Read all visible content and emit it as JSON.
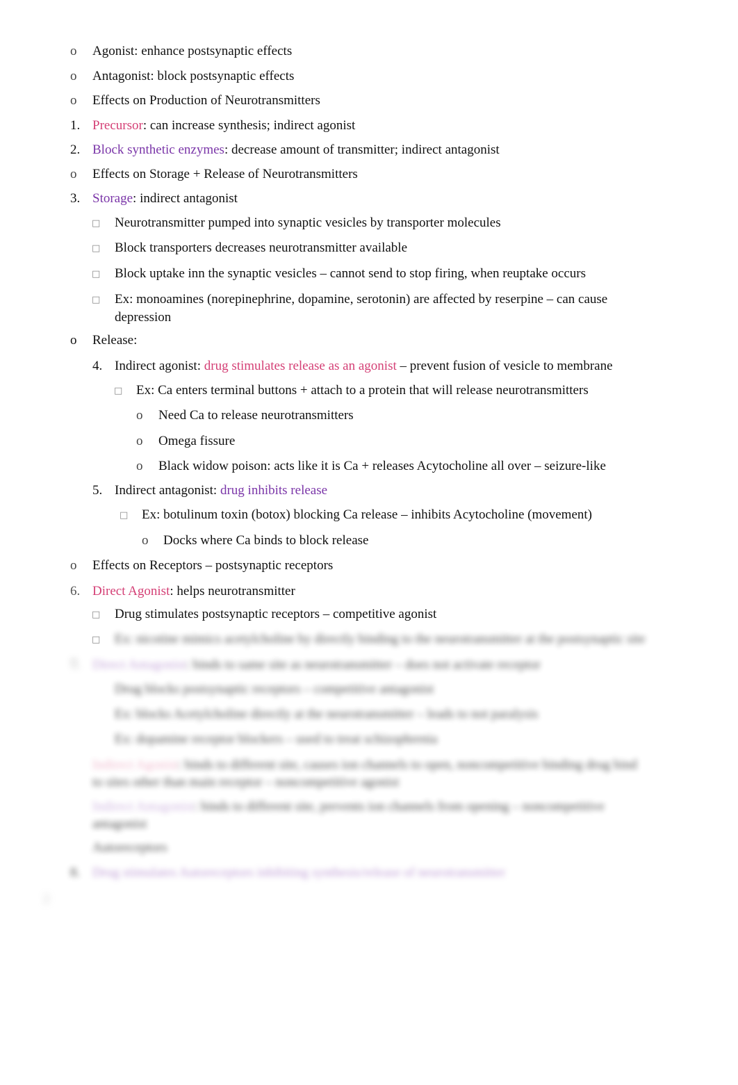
{
  "document": {
    "colors": {
      "accent_pink": "#d43f75",
      "accent_purple": "#7a35a8",
      "text": "#111111"
    },
    "lines": [
      {
        "marker": "o",
        "text": "Agonist: enhance postsynaptic effects"
      },
      {
        "marker": "o",
        "text": "Antagonist: block postsynaptic effects"
      },
      {
        "marker": "o",
        "text": "Effects on Production of Neurotransmitters"
      },
      {
        "marker": "1.",
        "highlight": "Precursor",
        "text": ": can increase synthesis; indirect agonist"
      },
      {
        "marker": "2.",
        "highlight": "Block synthetic enzymes",
        "text": ": decrease amount of transmitter; indirect antagonist"
      },
      {
        "marker": "o",
        "text": "Effects on Storage + Release of Neurotransmitters"
      },
      {
        "marker": "3.",
        "highlight": "Storage",
        "text": ": indirect antagonist"
      },
      {
        "marker": "□",
        "text": "Neurotransmitter pumped into synaptic vesicles by transporter molecules"
      },
      {
        "marker": "□",
        "text": "Block transporters decreases neurotransmitter available"
      },
      {
        "marker": "□",
        "text": "Block uptake inn the synaptic vesicles – cannot send to stop firing, when reuptake occurs"
      },
      {
        "marker": "□",
        "text": "Ex: monoamines (norepinephrine, dopamine, serotonin) are affected by reserpine – can cause",
        "text2": "depression"
      },
      {
        "marker": "o",
        "text": "Release:"
      },
      {
        "marker": "4.",
        "prefix": "Indirect agonist: ",
        "highlight": "drug stimulates release as an agonist",
        "text": " – prevent fusion of vesicle to membrane"
      },
      {
        "marker": "□",
        "text": "Ex: Ca enters terminal buttons + attach to a protein that will release neurotransmitters"
      },
      {
        "marker": "o",
        "text": "Need Ca to release neurotransmitters"
      },
      {
        "marker": "o",
        "text": "Omega fissure"
      },
      {
        "marker": "o",
        "text": "Black widow poison: acts like it is Ca + releases Acytocholine all over – seizure-like"
      },
      {
        "marker": "5.",
        "prefix": "Indirect antagonist: ",
        "highlight": "drug inhibits release"
      },
      {
        "marker": "□",
        "text": "Ex: botulinum toxin (botox) blocking Ca release – inhibits Acytocholine (movement)"
      },
      {
        "marker": "o",
        "text": "Docks where Ca binds to block release"
      },
      {
        "marker": "o",
        "text": "Effects on Receptors – postsynaptic receptors"
      },
      {
        "marker": "6.",
        "highlight": "Direct Agonist",
        "text": ": helps neurotransmitter"
      },
      {
        "marker": "□",
        "text": "Drug stimulates postsynaptic receptors – competitive agonist"
      }
    ],
    "blurred": {
      "l1": "Ex: nicotine mimics acetylcholine by directly binding to the neurotransmitter at the postsynaptic site",
      "l2h": "Direct Antagonist",
      "l2": ": binds to same site as neurotransmitter – does not activate receptor",
      "l3": "Drug blocks postsynaptic receptors – competitive antagonist",
      "l4": "Ex: blocks Acetylcholine directly at the neurotransmitter – leads to not paralysis",
      "l5": "Ex: dopamine receptor blockers – used to treat schizophrenia",
      "l6h": "Indirect Agonist",
      "l6": ": binds to different site, causes ion channels to open, noncompetitive binding drug bind",
      "l6b": "to sites other than main receptor – noncompetitive agonist",
      "l7h": "Indirect Antagonist",
      "l7": ": binds to different site, prevents ion channels from opening – noncompetitive",
      "l7b": "antagonist",
      "l8": "Autoreceptors",
      "l9h": "Drug stimulates Autoreceptors inhibiting synthesis/release of neurotransmitter",
      "page": "2"
    }
  }
}
